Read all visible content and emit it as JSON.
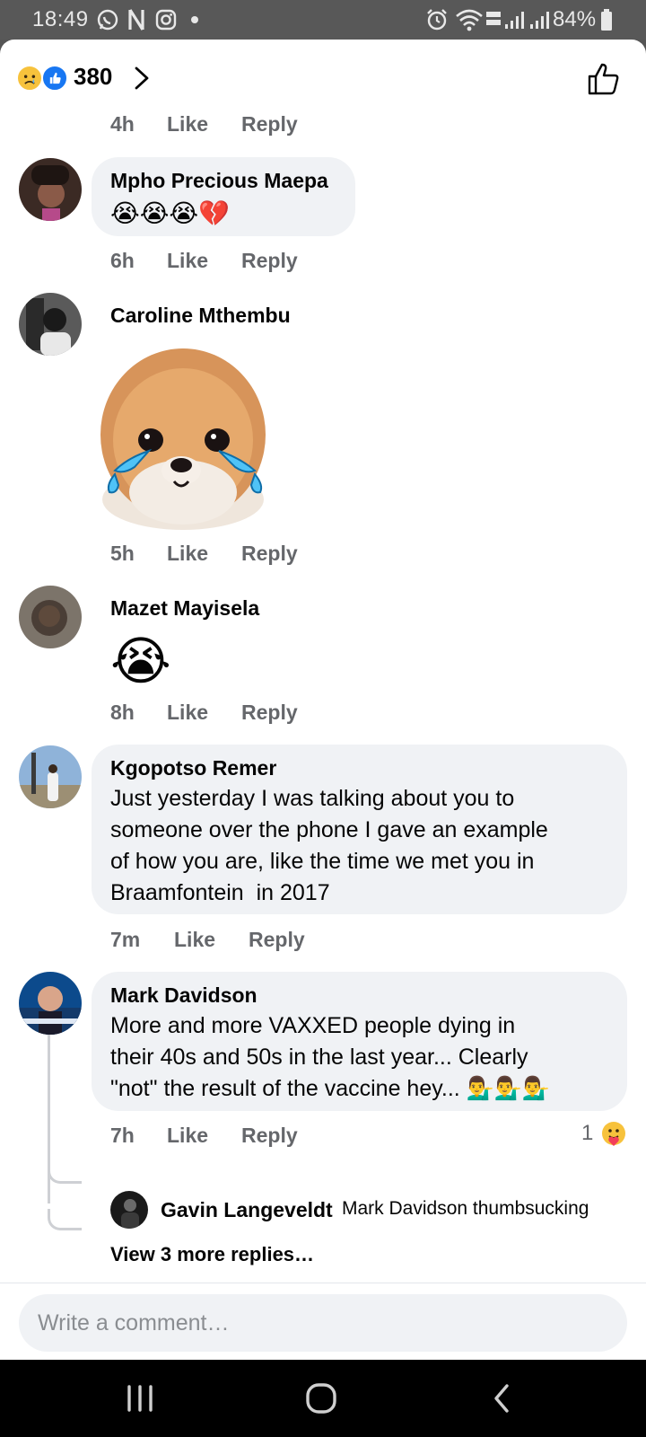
{
  "status_bar": {
    "time": "18:49",
    "battery": "84%"
  },
  "header": {
    "reaction_count": "380"
  },
  "comments": [
    {
      "time": "4h",
      "like": "Like",
      "reply": "Reply"
    },
    {
      "name": "Mpho Precious Maepa",
      "emoji_text": "😭😭😭💔",
      "time": "6h",
      "like": "Like",
      "reply": "Reply"
    },
    {
      "name": "Caroline Mthembu",
      "time": "5h",
      "like": "Like",
      "reply": "Reply"
    },
    {
      "name": "Mazet Mayisela",
      "emoji_text": "😭",
      "time": "8h",
      "like": "Like",
      "reply": "Reply"
    },
    {
      "name": "Kgopotso Remer",
      "text_lines": [
        "Just yesterday I was talking about you to",
        "someone over the phone I gave an example",
        "of how you are, like the time we met you in",
        "Braamfontein  in 2017"
      ],
      "time": "7m",
      "like": "Like",
      "reply": "Reply"
    },
    {
      "name": "Mark Davidson",
      "text_lines": [
        "More and more VAXXED people dying in",
        "their 40s and 50s in the last year... Clearly",
        "\"not\" the result of the vaccine hey... 💁‍♂️💁‍♂️💁‍♂️"
      ],
      "time": "7h",
      "like": "Like",
      "reply": "Reply",
      "reaction_count": "1"
    }
  ],
  "reply_preview": {
    "name": "Gavin Langeveldt",
    "text": "Mark Davidson thumbsucking"
  },
  "view_more": "View 3 more replies…",
  "composer": {
    "placeholder": "Write a comment…"
  },
  "colors": {
    "facebook_blue": "#1877f2",
    "bubble": "#f0f2f5",
    "meta_gray": "#65676b",
    "text": "#050505"
  }
}
